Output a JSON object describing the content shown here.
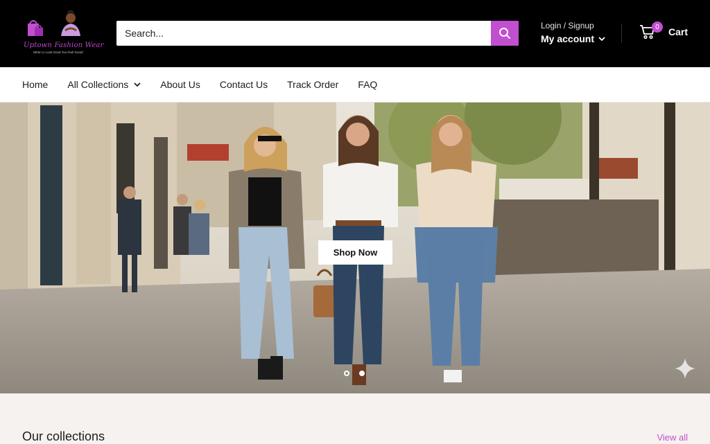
{
  "header": {
    "logo": {
      "name": "Uptown Fashion Wear",
      "tagline": "When U Look Good You Feel Good!"
    },
    "search": {
      "placeholder": "Search..."
    },
    "account": {
      "sub_label": "Login / Signup",
      "main_label": "My account"
    },
    "cart": {
      "count": "0",
      "label": "Cart"
    }
  },
  "nav": {
    "items": [
      {
        "label": "Home"
      },
      {
        "label": "All Collections",
        "has_dropdown": true
      },
      {
        "label": "About Us"
      },
      {
        "label": "Contact Us"
      },
      {
        "label": "Track Order"
      },
      {
        "label": "FAQ"
      }
    ]
  },
  "hero": {
    "cta_label": "Shop Now",
    "slides": 2,
    "active_slide": 2
  },
  "collections": {
    "title": "Our collections",
    "view_all_label": "View all"
  },
  "colors": {
    "accent": "#c14fd0",
    "header_bg": "#000000",
    "section_bg": "#f5f2ef"
  },
  "icons": [
    "search-icon",
    "chevron-down-icon",
    "cart-icon",
    "sparkle-icon"
  ]
}
